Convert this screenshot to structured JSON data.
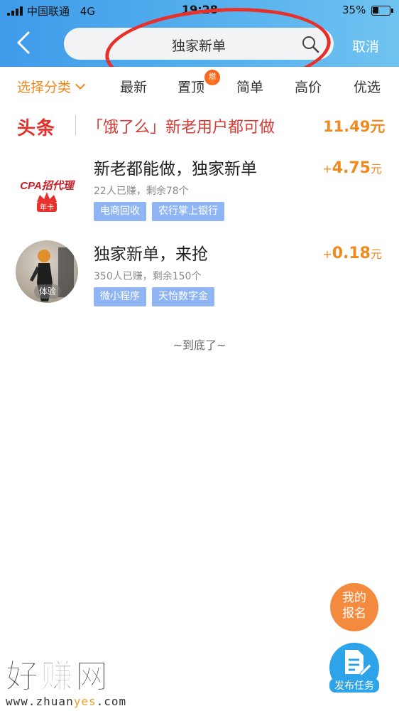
{
  "status_bar": {
    "carrier": "中国联通",
    "network": "4G",
    "time": "19:28",
    "battery_percent": "35%",
    "battery_level": 0.35
  },
  "nav": {
    "search_value": "独家新单",
    "cancel_label": "取消",
    "back_icon": "chevron-left-icon",
    "search_icon": "search-icon"
  },
  "tabs": {
    "category_label": "选择分类",
    "items": [
      "最新",
      "置顶",
      "简单",
      "高价",
      "优选"
    ],
    "hot_badge": "燃"
  },
  "headline": {
    "logo": "头条",
    "text": "「饿了么」新老用户都可做",
    "price": "11.49元"
  },
  "tasks": [
    {
      "title": "新老都能做，独家新单",
      "meta": "22人已赚，剩余78个",
      "tags": [
        "电商回收",
        "农行掌上银行"
      ],
      "reward_sign": "+",
      "reward": "4.75",
      "unit": "元",
      "avatar_text": "CPA招代理",
      "avatar_badge": "年卡"
    },
    {
      "title": "独家新单，来抢",
      "meta": "350人已赚，剩余150个",
      "tags": [
        "微小程序",
        "天怡数字金"
      ],
      "reward_sign": "+",
      "reward": "0.18",
      "unit": "元",
      "avatar_badge": "体验"
    }
  ],
  "end_text": "~到底了~",
  "floating": {
    "signup_line1": "我的",
    "signup_line2": "报名",
    "publish_label": "发布任务"
  },
  "watermark": {
    "title": "好赚网",
    "url_prefix": "www.zhuan",
    "url_accent": "yes",
    "url_suffix": ".com"
  },
  "colors": {
    "nav_blue": "#3f9be9",
    "accent_orange": "#f18a1e",
    "headline_red": "#e5312c",
    "tag_blue": "#8fb5f5",
    "annotation_red": "#e8302a"
  }
}
